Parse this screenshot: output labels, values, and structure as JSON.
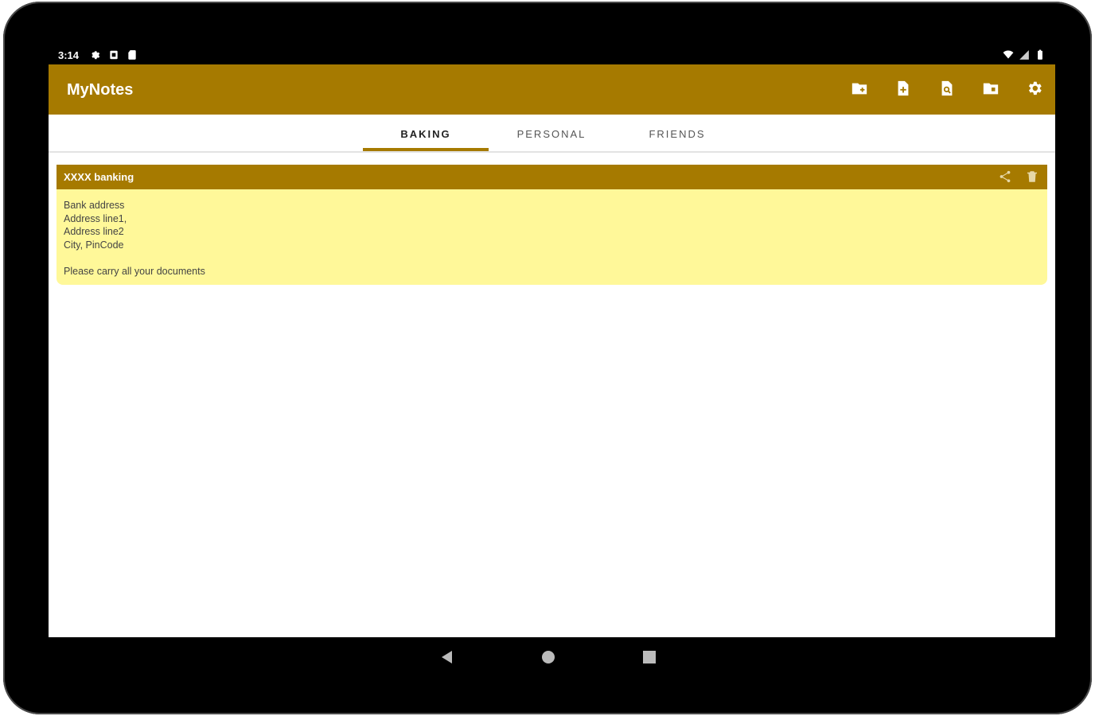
{
  "status_bar": {
    "time": "3:14",
    "left_icons": [
      "settings-icon",
      "screenshot-icon",
      "sd-card-icon"
    ],
    "right_icons": [
      "wifi-icon",
      "signal-icon",
      "battery-icon"
    ]
  },
  "app_bar": {
    "title": "MyNotes",
    "actions": [
      {
        "name": "new-folder-icon",
        "label": "New folder"
      },
      {
        "name": "new-note-icon",
        "label": "New note"
      },
      {
        "name": "search-note-icon",
        "label": "Find note"
      },
      {
        "name": "folder-icon",
        "label": "Folder"
      },
      {
        "name": "settings-icon",
        "label": "Settings"
      }
    ]
  },
  "tabs": [
    {
      "label": "BAKING",
      "active": true
    },
    {
      "label": "PERSONAL",
      "active": false
    },
    {
      "label": "FRIENDS",
      "active": false
    }
  ],
  "notes": [
    {
      "title": "XXXX banking",
      "body": [
        "Bank address",
        "Address line1,",
        "Address line2",
        "City, PinCode",
        "",
        "Please carry all your documents"
      ]
    }
  ],
  "nav_bar": [
    "back-icon",
    "home-icon",
    "recents-icon"
  ],
  "colors": {
    "accent": "#a67a00",
    "note_bg": "#fff899",
    "tab_indicator": "#a67a00"
  }
}
